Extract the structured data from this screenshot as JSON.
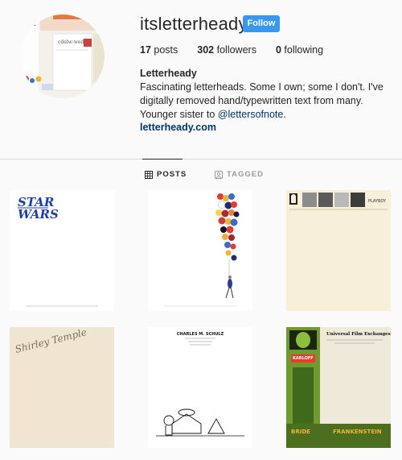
{
  "profile": {
    "username": "itsletterheady",
    "follow_label": "Follow",
    "name": "Letterheady",
    "bio": "Fascinating letterheads. Some I own; some I don't. I've digitally removed hand/typewritten text from many. Younger sister to",
    "mention": "@lettersofnote",
    "mention_suffix": ".",
    "website": "letterheady.com"
  },
  "stats": {
    "posts_count": "17",
    "posts_label": "posts",
    "followers_count": "302",
    "followers_label": "followers",
    "following_count": "0",
    "following_label": "following"
  },
  "tabs": {
    "posts": "POSTS",
    "tagged": "TAGGED"
  },
  "posts": [
    {
      "alt": "Star Wars letterhead",
      "logo_text": "STAR WARS",
      "logo_color": "#1f3fa8"
    },
    {
      "alt": "Balloons letterhead"
    },
    {
      "alt": "Playboy letterhead",
      "header_text": "PLAYBOY"
    },
    {
      "alt": "Shirley Temple letterhead",
      "signature": "Shirley Temple"
    },
    {
      "alt": "Charles M. Schulz letterhead",
      "header_text": "CHARLES M. SCHULZ"
    },
    {
      "alt": "Universal Pictures letterhead",
      "header_text": "Universal Film Exchanges Inc.",
      "poster_title": "BRIDE OF FRANKENSTEIN",
      "poster_name": "KARLOFF"
    }
  ],
  "icons": {
    "posts_tab": "grid-icon",
    "tagged_tab": "tag-user-icon"
  },
  "colors": {
    "accent": "#3897f0",
    "link": "#003569",
    "background": "#fafafa"
  }
}
